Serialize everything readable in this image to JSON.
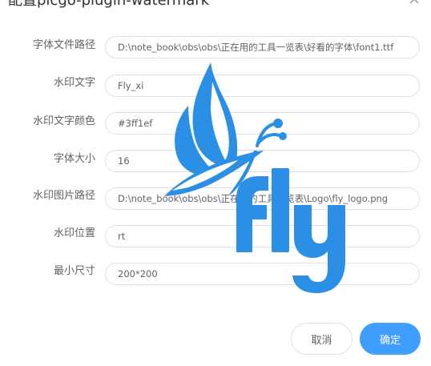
{
  "dialog": {
    "title": "配置picgo-plugin-watermark"
  },
  "form": {
    "fields": [
      {
        "label": "字体文件路径",
        "value": "D:\\note_book\\obs\\obs\\正在用的工具一览表\\好看的字体\\font1.ttf"
      },
      {
        "label": "水印文字",
        "value": "Fly_xi"
      },
      {
        "label": "水印文字颜色",
        "value": "#3ff1ef"
      },
      {
        "label": "字体大小",
        "value": "16"
      },
      {
        "label": "水印图片路径",
        "value": "D:\\note_book\\obs\\obs\\正在用的工具一览表\\Logo\\fly_logo.png"
      },
      {
        "label": "水印位置",
        "value": "rt"
      },
      {
        "label": "最小尺寸",
        "value": "200*200"
      }
    ]
  },
  "watermark": {
    "icon": "butterfly-fly-logo",
    "color": "#2b8fe6"
  },
  "footer": {
    "cancel_label": "取消",
    "confirm_label": "确定"
  },
  "colors": {
    "primary": "#409eff",
    "border": "#dcdfe6",
    "text": "#606266"
  }
}
